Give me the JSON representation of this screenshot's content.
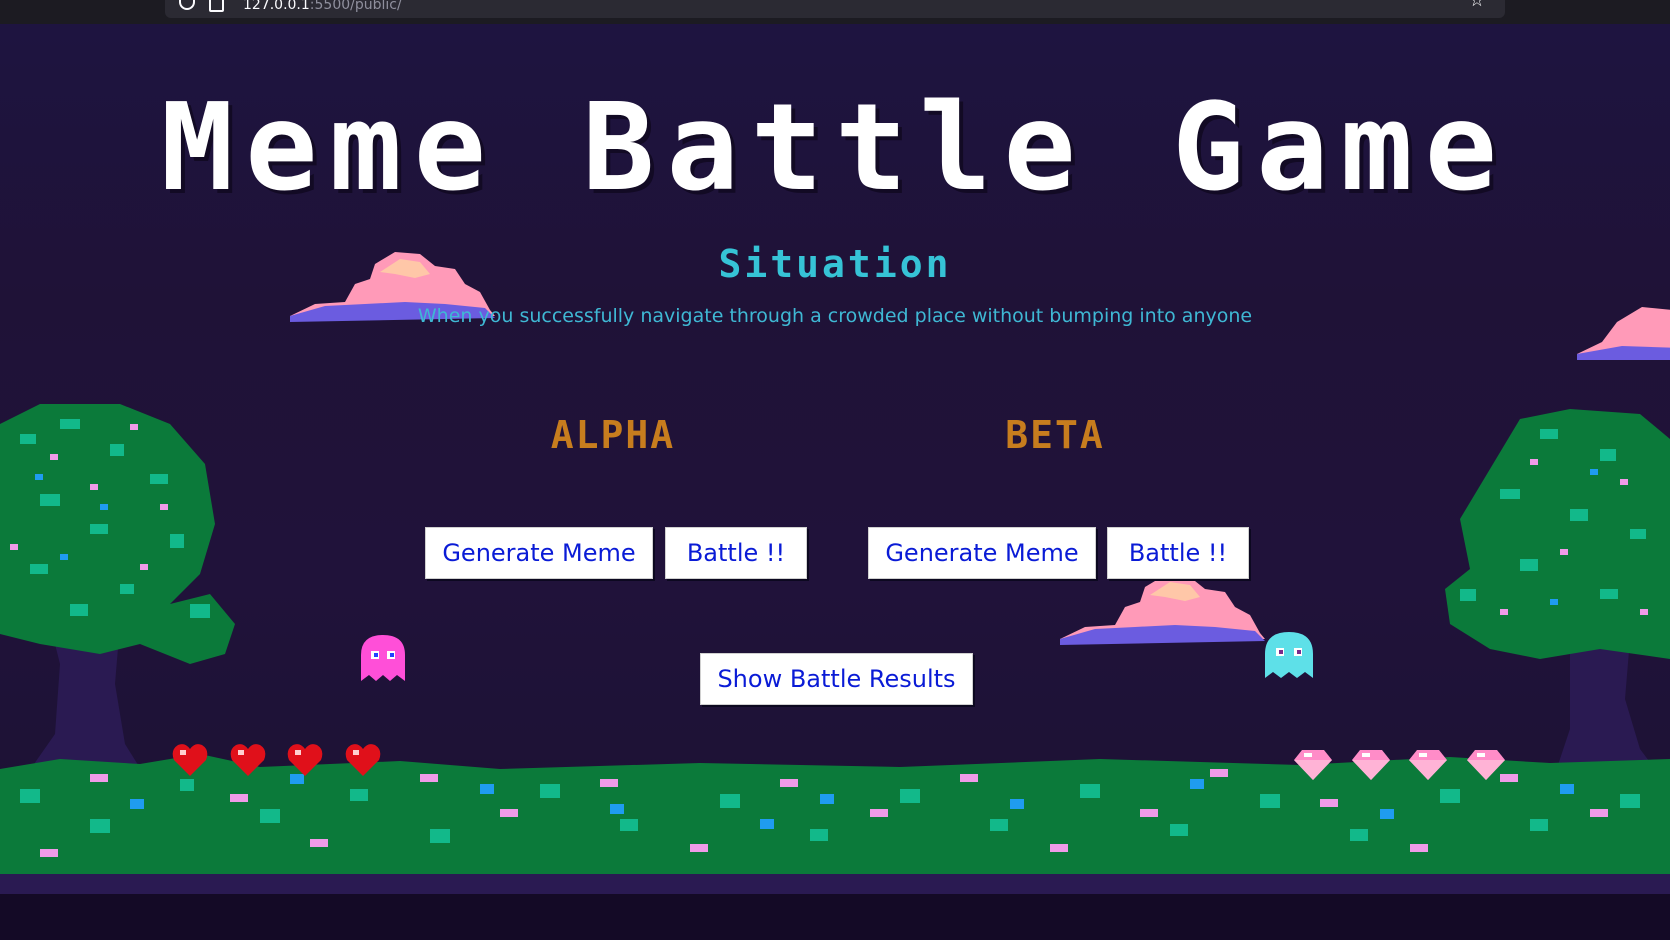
{
  "browser": {
    "url_host": "127.0.0.1",
    "url_rest": ":5500/public/"
  },
  "game": {
    "title": "Meme Battle Game",
    "situation_heading": "Situation",
    "situation_text": "When you successfully navigate through a crowded place without bumping into anyone",
    "teams": {
      "alpha": {
        "name": "ALPHA",
        "generate_label": "Generate Meme",
        "battle_label": "Battle !!"
      },
      "beta": {
        "name": "BETA",
        "generate_label": "Generate Meme",
        "battle_label": "Battle !!"
      }
    },
    "show_results_label": "Show Battle Results",
    "lives_hearts": 4,
    "gems": 4
  },
  "colors": {
    "background": "#1d1338",
    "title": "#ffffff",
    "situation": "#36c3d6",
    "team_name": "#c77d1e",
    "button_text": "#0a1bd6",
    "grass_dark": "#0a7a3a",
    "grass_light": "#12b98a",
    "flower_pink": "#ef9be8",
    "flower_blue": "#1f9cf0",
    "pink_ghost": "#ff4fd8",
    "cyan_ghost": "#5ee0e8",
    "heart": "#e0101a",
    "gem": "#ffb3d6"
  },
  "icons": [
    "shield-icon",
    "lock-icon",
    "bookmark-star-icon",
    "cloud-icon",
    "tree-icon",
    "pink-ghost-icon",
    "cyan-ghost-icon",
    "heart-icon",
    "gem-icon"
  ]
}
